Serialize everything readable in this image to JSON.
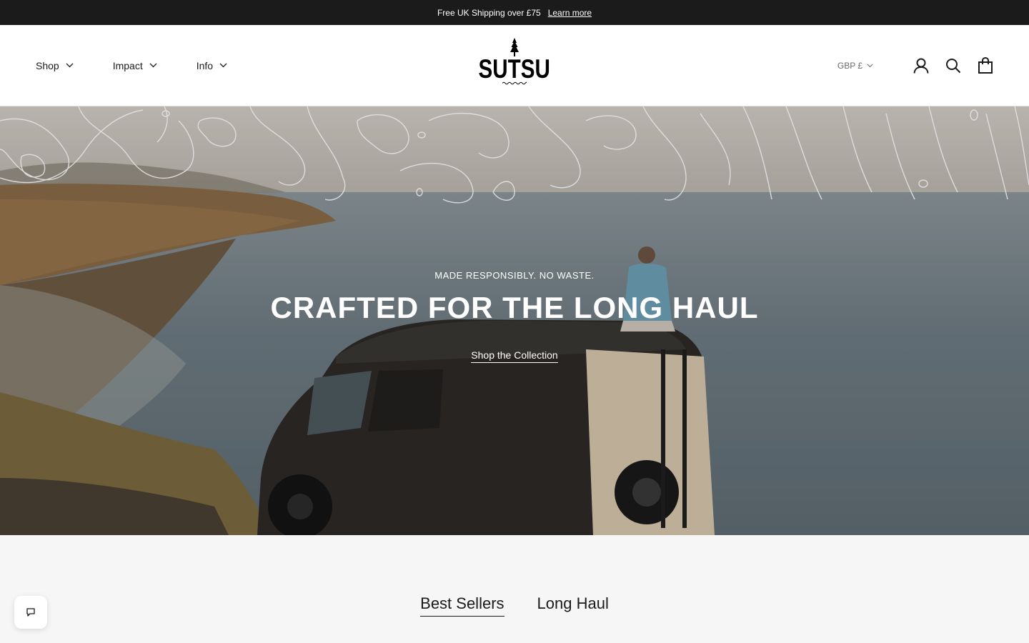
{
  "announcement": {
    "text": "Free UK Shipping over £75",
    "link": "Learn more"
  },
  "nav": {
    "items": [
      {
        "label": "Shop"
      },
      {
        "label": "Impact"
      },
      {
        "label": "Info"
      }
    ]
  },
  "logo": {
    "text": "SUTSU"
  },
  "header_right": {
    "currency": "GBP £",
    "icons": [
      "account-icon",
      "search-icon",
      "cart-icon"
    ]
  },
  "hero": {
    "subtitle": "MADE RESPONSIBLY. NO WASTE.",
    "title": "CRAFTED FOR THE LONG HAUL",
    "cta": "Shop the Collection"
  },
  "collection_tabs": [
    {
      "label": "Best Sellers",
      "active": true
    },
    {
      "label": "Long Haul",
      "active": false
    }
  ],
  "colors": {
    "announcement_bg": "#1c1b1b",
    "text": "#1c1b1b",
    "page_bg": "#f6f6f6"
  }
}
